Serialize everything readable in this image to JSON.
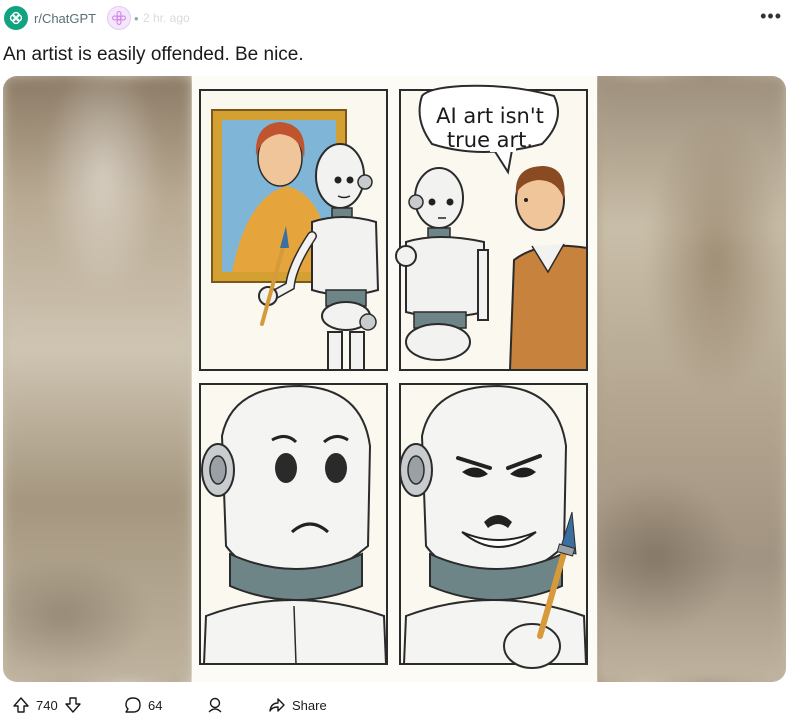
{
  "post": {
    "subreddit": "r/ChatGPT",
    "separator": "•",
    "time": "2 hr. ago",
    "more_label": "•••",
    "title": "An artist is easily offended. Be nice.",
    "comic": {
      "speech_line1": "AI art isn't",
      "speech_line2": "true art."
    }
  },
  "actions": {
    "upvotes": "740",
    "comments": "64",
    "share_label": "Share"
  },
  "colors": {
    "openai_green": "#10a37f",
    "meta_gray": "#576f76"
  }
}
